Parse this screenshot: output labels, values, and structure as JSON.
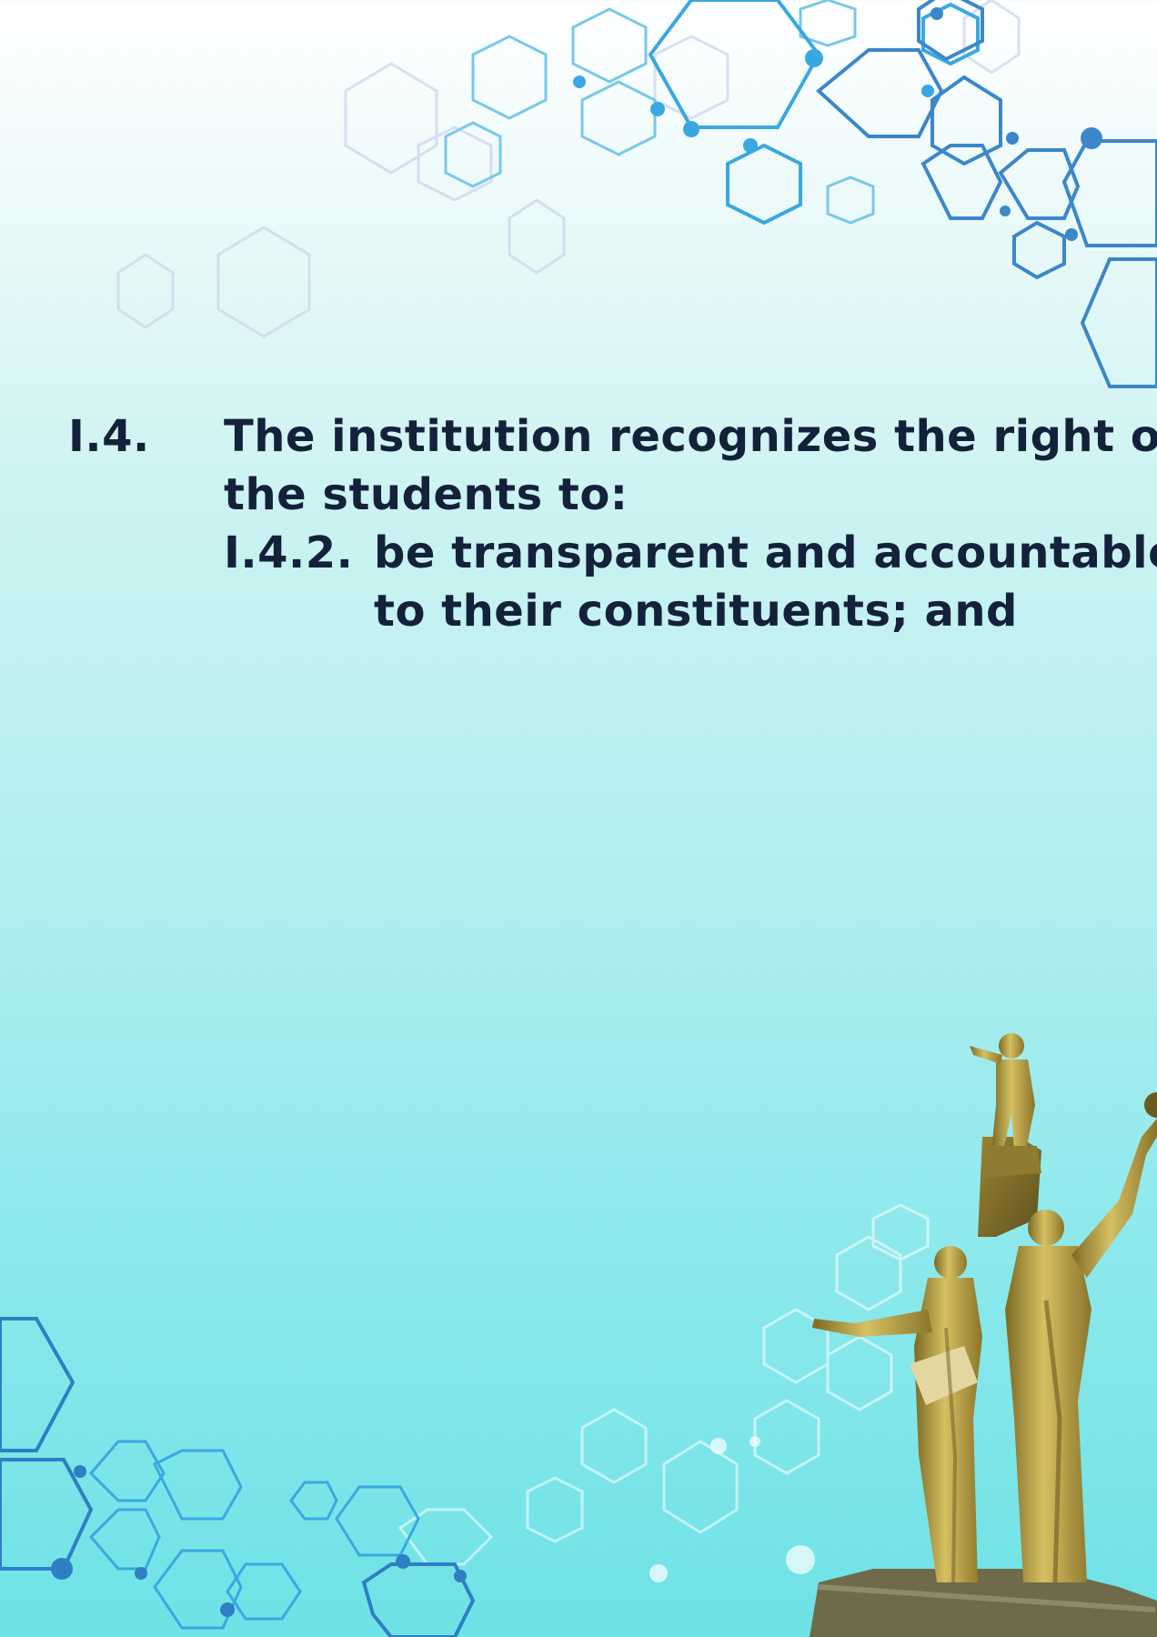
{
  "section": {
    "number": "I.4.",
    "heading_lines": [
      "The institution recognizes the right of",
      "the students to:"
    ]
  },
  "subsection": {
    "number": "I.4.2.",
    "lines": [
      "be transparent and accountable",
      "to their constituents; and"
    ]
  },
  "colors": {
    "text": "#14213a",
    "hex_blue": "#3a8fd0",
    "hex_light": "#78c8e8",
    "statue_gold": "#b79b3a"
  }
}
